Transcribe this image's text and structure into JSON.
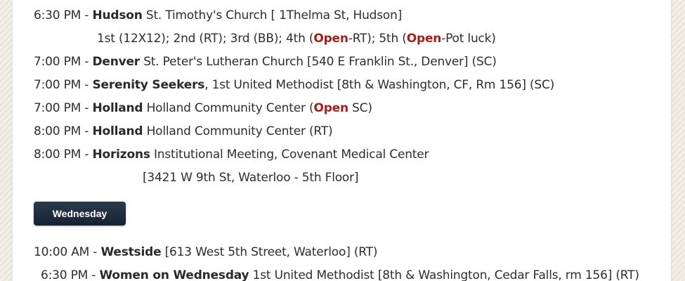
{
  "meetings_tuesday": [
    {
      "time": "6:30 PM - ",
      "name": "Hudson",
      "details": " St. Timothy's Church [ 1Thelma St, Hudson]"
    },
    {
      "schedule": {
        "p1": "1st (12X12); 2nd (RT); 3rd (BB); 4th (",
        "open1": "Open",
        "p2": "-RT); 5th (",
        "open2": "Open",
        "p3": "-Pot luck)"
      }
    },
    {
      "time": "7:00 PM - ",
      "name": "Denver",
      "details": " St. Peter's Lutheran Church [540 E Franklin St., Denver] (SC)"
    },
    {
      "time": "7:00 PM - ",
      "name": "Serenity Seekers",
      "details": ", 1st United Methodist [8th & Washington, CF, Rm 156] (SC)"
    },
    {
      "time": "7:00 PM - ",
      "name": "Holland",
      "details_pre": " Holland Community Center (",
      "open": "Open",
      "details_post": " SC)"
    },
    {
      "time": "8:00 PM - ",
      "name": "Holland",
      "details": " Holland Community Center (RT)"
    },
    {
      "time": "8:00 PM - ",
      "name": "Horizons",
      "details": " Institutional Meeting, Covenant Medical Center",
      "continuation": "[3421 W 9th St, Waterloo - 5th Floor]"
    }
  ],
  "day_button": {
    "label": "Wednesday"
  },
  "meetings_wednesday": [
    {
      "time": "10:00 AM - ",
      "name": "Westside",
      "details": "  [613 West 5th Street, Waterloo] (RT)"
    },
    {
      "time": "6:30 PM - ",
      "name": "Women on Wednesday",
      "details": " 1st United Methodist [8th & Washington, Cedar Falls, rm 156] (RT)"
    }
  ]
}
